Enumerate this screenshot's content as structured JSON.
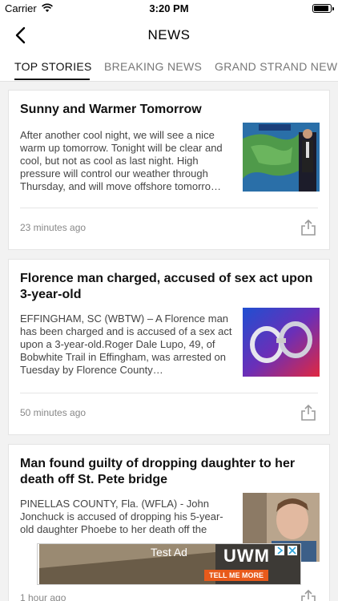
{
  "status_bar": {
    "carrier": "Carrier",
    "time": "3:20 PM",
    "icons": [
      "wifi-icon",
      "battery-icon"
    ],
    "battery_level": 0.9
  },
  "header": {
    "title": "NEWS",
    "back_icon": "back-chevron-icon"
  },
  "tabs": [
    {
      "label": "TOP STORIES",
      "active": true
    },
    {
      "label": "BREAKING NEWS",
      "active": false
    },
    {
      "label": "GRAND STRAND NEWS",
      "active": false
    }
  ],
  "articles": [
    {
      "title": "Sunny and Warmer Tomorrow",
      "excerpt": "After another cool night, we will see a nice warm up tomorrow. Tonight will be clear and cool, but not as cool as last night. High pressure will control our weather through Thursday, and will move offshore tomorro…",
      "time": "23 minutes ago",
      "thumbnail": "weather-map-thumbnail"
    },
    {
      "title": "Florence man charged, accused of sex act upon 3-year-old",
      "excerpt": "EFFINGHAM, SC (WBTW) – A Florence man has been charged and is accused of a sex act upon a 3-year-old.Roger Dale Lupo, 49, of Bobwhite Trail in Effingham, was arrested on Tuesday by Florence County…",
      "time": "50 minutes ago",
      "thumbnail": "handcuffs-thumbnail"
    },
    {
      "title": "Man found guilty of dropping daughter to her death off St. Pete bridge",
      "excerpt": "PINELLAS COUNTY, Fla. (WFLA) - John Jonchuck is accused of dropping his 5-year-old daughter Phoebe to her death off the",
      "time": "1 hour ago",
      "thumbnail": "defendant-photo-thumbnail"
    }
  ],
  "ad": {
    "label": "Test Ad",
    "brand": "UWM",
    "cta": "TELL ME MORE",
    "icons": [
      "ad-info-icon",
      "ad-close-icon"
    ]
  },
  "colors": {
    "background": "#f2f2f2",
    "card": "#ffffff",
    "ad_cta": "#e85a1b"
  }
}
